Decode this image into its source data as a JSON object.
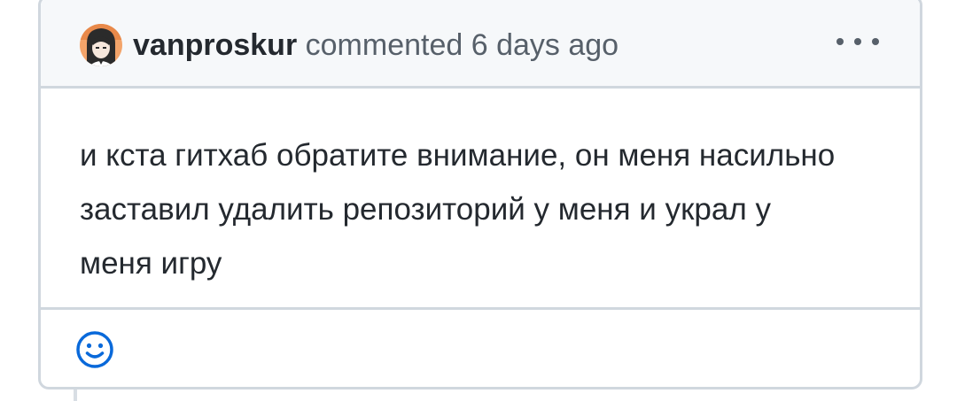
{
  "comment": {
    "author": "vanproskur",
    "meta": "commented 6 days ago",
    "body_lines": [
      "и кста гитхаб обратите внимание, он меня насильно",
      "заставил удалить репозиторий у меня и украл у",
      "меня игру"
    ]
  },
  "icons": {
    "avatar": "avatar-image",
    "more": "kebab-horizontal-icon",
    "reaction": "smiley-icon"
  },
  "colors": {
    "border": "#d0d7de",
    "header_bg": "#f6f8fa",
    "text": "#24292f",
    "muted": "#57606a",
    "accent": "#0969da"
  }
}
